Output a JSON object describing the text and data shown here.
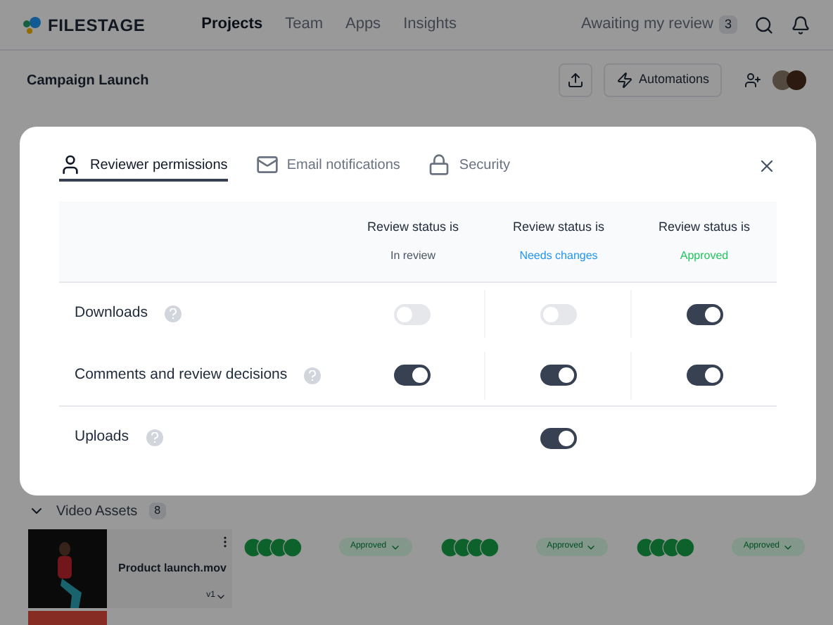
{
  "app": {
    "logo": "FILESTAGE",
    "nav": [
      {
        "label": "Projects",
        "selected": true
      },
      {
        "label": "Team",
        "selected": false
      },
      {
        "label": "Apps",
        "selected": false
      },
      {
        "label": "Insights",
        "selected": false
      }
    ],
    "awaiting": {
      "label": "Awaiting my review",
      "count": "3"
    }
  },
  "project": {
    "title": "Campaign Launch",
    "automations": "Automations"
  },
  "section": {
    "title": "Video Assets",
    "count": "8"
  },
  "assets": [
    {
      "name": "Product launch.mov",
      "version": "v1",
      "steps": [
        {
          "status": "Approved"
        },
        {
          "status": "Approved"
        },
        {
          "status": "Approved"
        }
      ]
    }
  ],
  "dialog": {
    "tabs": [
      {
        "label": "Reviewer permissions",
        "selected": true
      },
      {
        "label": "Email notifications",
        "selected": false
      },
      {
        "label": "Security",
        "selected": false
      }
    ],
    "columns": [
      {
        "heading": "Review status is",
        "status": "In review",
        "color": "#4b5563"
      },
      {
        "heading": "Review status is",
        "status": "Needs changes",
        "color": "#2196f3"
      },
      {
        "heading": "Review status is",
        "status": "Approved",
        "color": "#22c55e"
      }
    ],
    "rows": [
      {
        "label": "Downloads",
        "toggles": [
          {
            "kind": "toggle",
            "on": false
          },
          {
            "kind": "toggle",
            "on": false
          },
          {
            "kind": "toggle",
            "on": true
          }
        ]
      },
      {
        "label": "Comments and review decisions",
        "toggles": [
          {
            "kind": "toggle",
            "on": true
          },
          {
            "kind": "toggle",
            "on": true
          },
          {
            "kind": "toggle",
            "on": true
          }
        ]
      },
      {
        "label": "Uploads",
        "toggles": [
          {
            "kind": "empty"
          },
          {
            "kind": "toggle",
            "on": true
          },
          {
            "kind": "empty"
          }
        ]
      }
    ]
  }
}
